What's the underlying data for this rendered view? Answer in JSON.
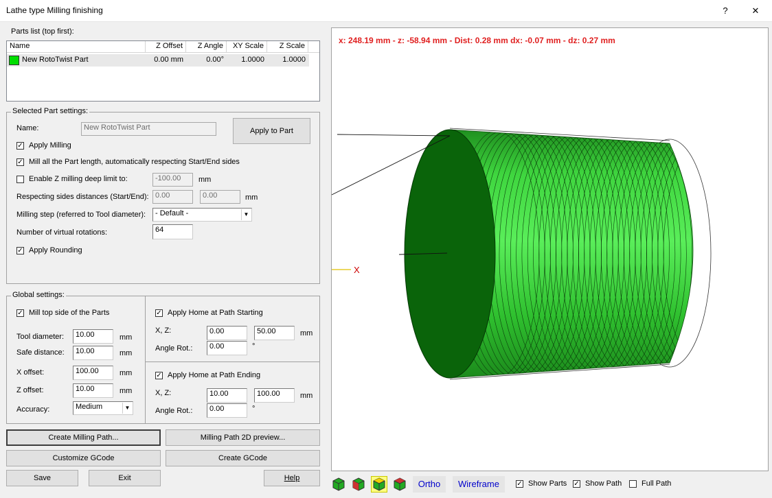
{
  "window": {
    "title": "Lathe type Milling finishing",
    "help_glyph": "?",
    "close_glyph": "✕"
  },
  "parts_list": {
    "label": "Parts list (top first):",
    "columns": [
      "Name",
      "Z Offset",
      "Z Angle",
      "XY Scale",
      "Z Scale"
    ],
    "rows": [
      {
        "name": "New RotoTwist Part",
        "z_offset": "0.00 mm",
        "z_angle": "0.00°",
        "xy_scale": "1.0000",
        "z_scale": "1.0000",
        "color": "#00dd00"
      }
    ]
  },
  "selected_part": {
    "group_label": "Selected Part settings:",
    "name_label": "Name:",
    "name_value": "New RotoTwist Part",
    "apply_to_part": "Apply to Part",
    "apply_milling": "Apply Milling",
    "mill_all_length": "Mill all the Part length, automatically respecting Start/End sides",
    "enable_z_limit": "Enable Z milling deep limit to:",
    "z_limit_value": "-100.00",
    "z_limit_unit": "mm",
    "sides_label": "Respecting sides distances (Start/End):",
    "side_start": "0.00",
    "side_end": "0.00",
    "sides_unit": "mm",
    "milling_step_label": "Milling step (referred to Tool diameter):",
    "milling_step_value": "- Default -",
    "rotations_label": "Number of virtual rotations:",
    "rotations_value": "64",
    "apply_rounding": "Apply Rounding"
  },
  "global": {
    "group_label": "Global settings:",
    "mill_top": "Mill top side of the Parts",
    "tool_diameter_label": "Tool diameter:",
    "tool_diameter": "10.00",
    "safe_distance_label": "Safe distance:",
    "safe_distance": "10.00",
    "x_offset_label": "X offset:",
    "x_offset": "100.00",
    "z_offset_label": "Z offset:",
    "z_offset": "10.00",
    "accuracy_label": "Accuracy:",
    "accuracy": "Medium",
    "unit": "mm",
    "home_start": {
      "label": "Apply Home at Path Starting",
      "xz_label": "X, Z:",
      "x": "0.00",
      "z": "50.00",
      "angle_label": "Angle Rot.:",
      "angle": "0.00",
      "deg": "°"
    },
    "home_end": {
      "label": "Apply Home at Path Ending",
      "xz_label": "X, Z:",
      "x": "10.00",
      "z": "100.00",
      "angle_label": "Angle Rot.:",
      "angle": "0.00",
      "deg": "°"
    }
  },
  "buttons": {
    "create_path": "Create Milling Path...",
    "preview_2d": "Milling Path 2D preview...",
    "customize_gcode": "Customize GCode",
    "create_gcode": "Create GCode",
    "save": "Save",
    "exit": "Exit",
    "help": "Help"
  },
  "viewport": {
    "coords": "x: 248.19 mm - z: -58.94 mm - Dist: 0.28 mm dx: -0.07 mm - dz: 0.27 mm",
    "axis_label": "X",
    "coords_color": "#e02020",
    "part_color": "#22bb22",
    "toolbar": {
      "ortho": "Ortho",
      "wireframe": "Wireframe",
      "show_parts": "Show Parts",
      "show_path": "Show Path",
      "full_path": "Full Path"
    }
  }
}
